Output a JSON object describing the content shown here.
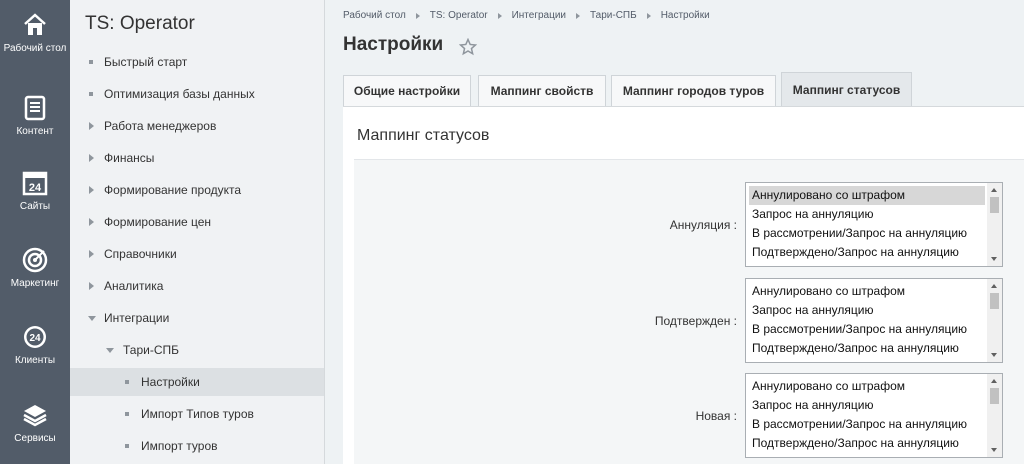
{
  "rail": [
    {
      "label": "Рабочий стол",
      "icon": "home-icon"
    },
    {
      "label": "Контент",
      "icon": "document-icon"
    },
    {
      "label": "Сайты",
      "icon": "calendar-24-icon"
    },
    {
      "label": "Маркетинг",
      "icon": "target-icon"
    },
    {
      "label": "Клиенты",
      "icon": "clock-24-icon"
    },
    {
      "label": "Сервисы",
      "icon": "layers-icon"
    }
  ],
  "menu": {
    "title": "TS: Operator",
    "items": [
      {
        "label": "Быстрый старт"
      },
      {
        "label": "Оптимизация базы данных"
      },
      {
        "label": "Работа менеджеров"
      },
      {
        "label": "Финансы"
      },
      {
        "label": "Формирование продукта"
      },
      {
        "label": "Формирование цен"
      },
      {
        "label": "Справочники"
      },
      {
        "label": "Аналитика"
      },
      {
        "label": "Интеграции"
      },
      {
        "label": "Тари-СПБ"
      },
      {
        "label": "Настройки"
      },
      {
        "label": "Импорт Типов туров"
      },
      {
        "label": "Импорт туров"
      }
    ]
  },
  "breadcrumb": [
    "Рабочий стол",
    "TS: Operator",
    "Интеграции",
    "Тари-СПБ",
    "Настройки"
  ],
  "page_title": "Настройки",
  "tabs": [
    {
      "label": "Общие настройки"
    },
    {
      "label": "Маппинг свойств"
    },
    {
      "label": "Маппинг городов туров"
    },
    {
      "label": "Маппинг статусов"
    }
  ],
  "panel_title": "Маппинг статусов",
  "fields": [
    {
      "label": "Аннуляция :",
      "options": [
        "Аннулировано со штрафом",
        "Запрос на аннуляцию",
        "В рассмотрении/Запрос на аннуляцию",
        "Подтверждено/Запрос на аннуляцию"
      ],
      "selected": 0
    },
    {
      "label": "Подтвержден :",
      "options": [
        "Аннулировано со штрафом",
        "Запрос на аннуляцию",
        "В рассмотрении/Запрос на аннуляцию",
        "Подтверждено/Запрос на аннуляцию"
      ]
    },
    {
      "label": "Новая :",
      "options": [
        "Аннулировано со штрафом",
        "Запрос на аннуляцию",
        "В рассмотрении/Запрос на аннуляцию",
        "Подтверждено/Запрос на аннуляцию"
      ]
    }
  ],
  "colors": {
    "rail": "#525c69",
    "menu": "#f0f2f4",
    "active_item": "#dce0e3",
    "selected_option": "#d7d7d7"
  }
}
